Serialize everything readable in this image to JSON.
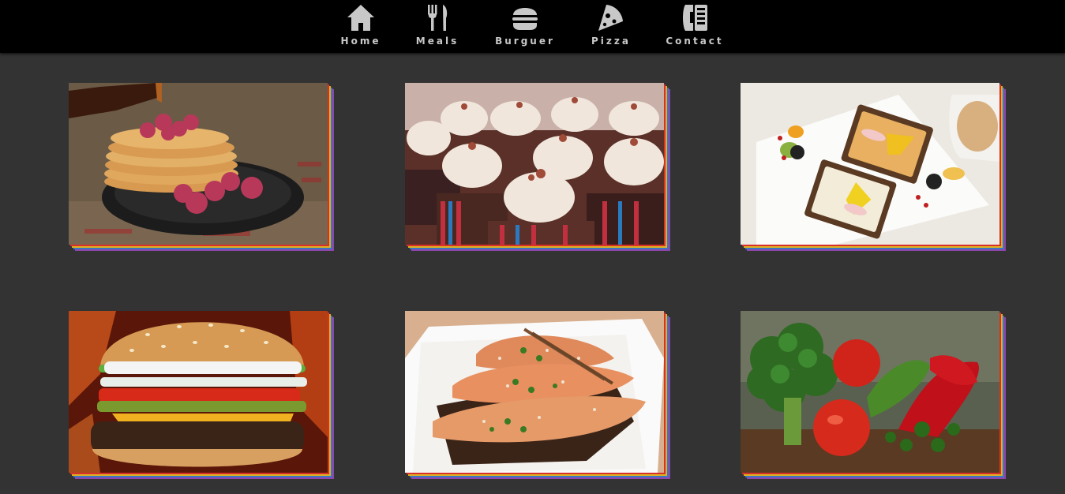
{
  "nav": {
    "items": [
      {
        "label": "Home",
        "icon": "home-icon"
      },
      {
        "label": "Meals",
        "icon": "fork-knife-icon"
      },
      {
        "label": "Burguer",
        "icon": "burger-icon"
      },
      {
        "label": "Pizza",
        "icon": "pizza-slice-icon"
      },
      {
        "label": "Contact",
        "icon": "contact-phone-icon"
      }
    ]
  },
  "gallery": {
    "items": [
      {
        "subject": "pancakes with raspberries and syrup"
      },
      {
        "subject": "chocolate cupcakes with cream frosting"
      },
      {
        "subject": "open sandwiches with fruit"
      },
      {
        "subject": "cheeseburger"
      },
      {
        "subject": "grilled salmon with sesame"
      },
      {
        "subject": "vegetables: broccoli, tomatoes, cucumber, peppers"
      }
    ],
    "border_colors": [
      "#d9302a",
      "#e0b020",
      "#3a78c2",
      "#8e44ad"
    ]
  },
  "colors": {
    "background": "#333333",
    "navbar": "#000000",
    "nav_text": "#c8c8c8"
  }
}
